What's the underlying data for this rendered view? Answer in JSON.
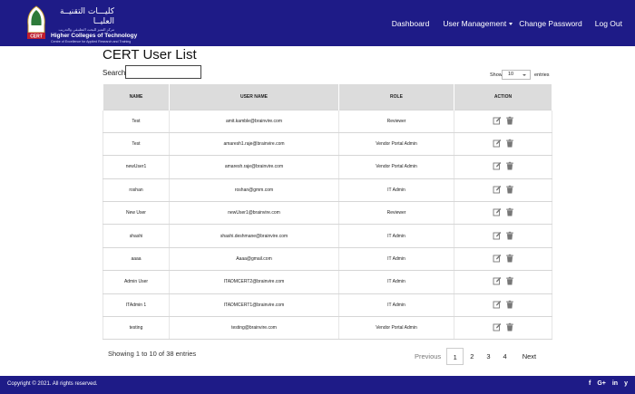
{
  "header": {
    "brand_ar": "كليـــات التقنيــة العليــا",
    "brand_ar_sub": "مركز التميز للبحث التطبيقي والتدريب",
    "brand_en": "Higher Colleges of Technology",
    "brand_en_sub": "Centre of Excellence for Applied Research and Training",
    "logo_text": "CERT",
    "nav": {
      "dashboard": "Dashboard",
      "user_management": "User Management",
      "change_password": "Change Password",
      "logout": "Log Out"
    }
  },
  "page": {
    "title": "CERT User List",
    "search_label": "Search:",
    "search_value": "",
    "show_label": "Show",
    "page_size": "10",
    "entries_label": "entries"
  },
  "table": {
    "headers": {
      "name": "NAME",
      "username": "USER NAME",
      "role": "ROLE",
      "action": "ACTION"
    },
    "rows": [
      {
        "name": "Test",
        "username": "amit.kamble@brainvire.com",
        "role": "Reviewer"
      },
      {
        "name": "Test",
        "username": "amaresh1.raje@brainvire.com",
        "role": "Vendor Portal Admin"
      },
      {
        "name": "newUser1",
        "username": "amaresh.raje@brainvire.com",
        "role": "Vendor Portal Admin"
      },
      {
        "name": "roshan",
        "username": "roshan@gmm.com",
        "role": "IT Admin"
      },
      {
        "name": "New User",
        "username": "newUser1@brainvire.com",
        "role": "Reviewer"
      },
      {
        "name": "shashi",
        "username": "shashi.deshmane@brainvire.com",
        "role": "IT Admin"
      },
      {
        "name": "aaaa",
        "username": "Aaaa@gmail.com",
        "role": "IT Admin"
      },
      {
        "name": "Admin User",
        "username": "ITADMCERT2@brainvire.com",
        "role": "IT Admin"
      },
      {
        "name": "ITAdmin 1",
        "username": "ITADMCERT1@brainvire.com",
        "role": "IT Admin"
      },
      {
        "name": "testing",
        "username": "testing@brainvire.com",
        "role": "Vendor Portal Admin"
      }
    ]
  },
  "pagination": {
    "summary": "Showing 1 to 10 of 38 entries",
    "previous": "Previous",
    "pages": [
      "1",
      "2",
      "3",
      "4"
    ],
    "current": "1",
    "next": "Next"
  },
  "footer": {
    "copyright": "Copyright © 2021. All rights reserved.",
    "social": [
      "f",
      "G+",
      "in",
      "y"
    ]
  },
  "colors": {
    "brand": "#1e1b87",
    "table_header": "#dcdcdc",
    "icon": "#777777"
  },
  "icons": [
    "edit-icon",
    "trash-icon",
    "facebook-icon",
    "google-plus-icon",
    "linkedin-icon",
    "twitter-icon"
  ]
}
